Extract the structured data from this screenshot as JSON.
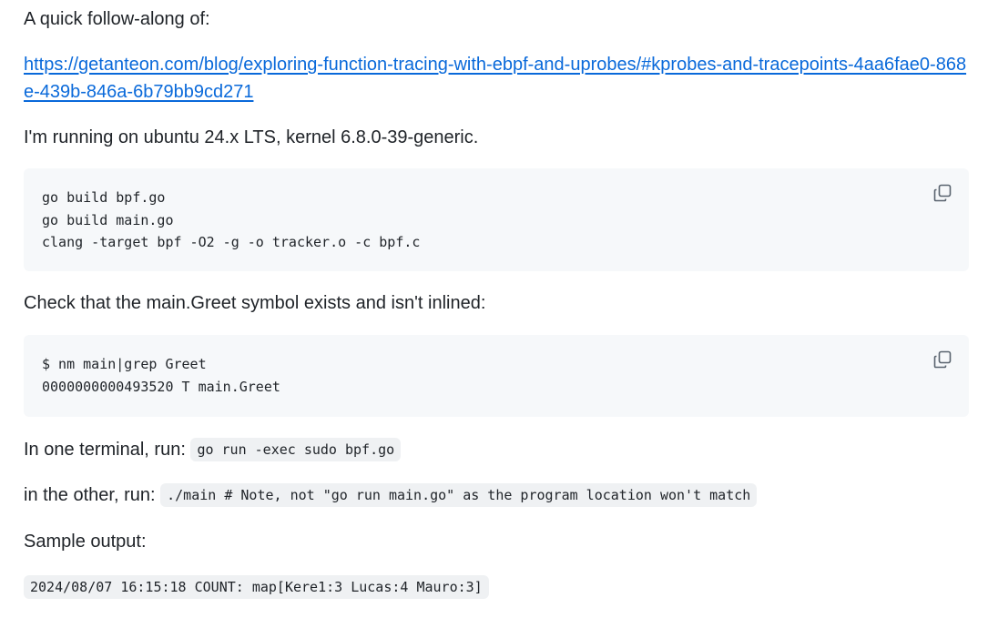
{
  "intro_text": "A quick follow-along of:",
  "link": {
    "text": "https://getanteon.com/blog/exploring-function-tracing-with-ebpf-and-uprobes/#kprobes-and-tracepoints-4aa6fae0-868e-439b-846a-6b79bb9cd271"
  },
  "environment_text": "I'm running on ubuntu 24.x LTS, kernel 6.8.0-39-generic.",
  "build_block": {
    "code": "go build bpf.go\ngo build main.go\nclang -target bpf -O2 -g -o tracker.o -c bpf.c",
    "copy_icon": "copy-icon"
  },
  "check_text": "Check that the main.Greet symbol exists and isn't inlined:",
  "nm_block": {
    "code": "$ nm main|grep Greet\n0000000000493520 T main.Greet",
    "copy_icon": "copy-icon"
  },
  "terminal1": {
    "prefix": "In one terminal, run:",
    "code": "go run -exec sudo bpf.go"
  },
  "terminal2": {
    "prefix": "in the other, run:",
    "code": "./main # Note, not \"go run main.go\" as the program location won't match"
  },
  "sample_label": "Sample output:",
  "sample_output": "2024/08/07 16:15:18 COUNT: map[Kere1:3 Lucas:4 Mauro:3]",
  "colors": {
    "text": "#1f2328",
    "link": "#0969da",
    "code_background": "#f6f8fa",
    "inline_code_background": "#eff1f3",
    "icon": "#59636e"
  }
}
